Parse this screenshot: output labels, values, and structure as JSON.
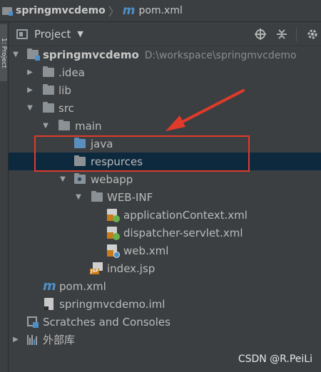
{
  "breadcrumb": {
    "project_name": "springmvcdemo",
    "file_name": "pom.xml",
    "maven_glyph": "m"
  },
  "side_tab": {
    "label": "1: Project"
  },
  "toolbar": {
    "title": "Project",
    "icons": [
      "crosshair-icon",
      "collapse-icon",
      "gear-icon"
    ]
  },
  "tree": {
    "root": {
      "label": "springmvcdemo",
      "path": "D:\\workspace\\springmvcdemo"
    },
    "idea": {
      "label": ".idea"
    },
    "lib": {
      "label": "lib"
    },
    "src": {
      "label": "src"
    },
    "main": {
      "label": "main"
    },
    "java": {
      "label": "java"
    },
    "respurces": {
      "label": "respurces"
    },
    "webapp": {
      "label": "webapp"
    },
    "webinf": {
      "label": "WEB-INF"
    },
    "applicationContext": {
      "label": "applicationContext.xml"
    },
    "dispatcher": {
      "label": "dispatcher-servlet.xml"
    },
    "webxml": {
      "label": "web.xml"
    },
    "indexjsp": {
      "label": "index.jsp",
      "badge": "JSP"
    },
    "pom": {
      "label": "pom.xml",
      "glyph": "m"
    },
    "iml": {
      "label": "springmvcdemo.iml"
    },
    "scratches": {
      "label": "Scratches and Consoles"
    },
    "external": {
      "label": "外部库"
    }
  },
  "annotation": {
    "color": "#e03a2b"
  },
  "watermark": {
    "text": "CSDN @R.PeiLi"
  }
}
